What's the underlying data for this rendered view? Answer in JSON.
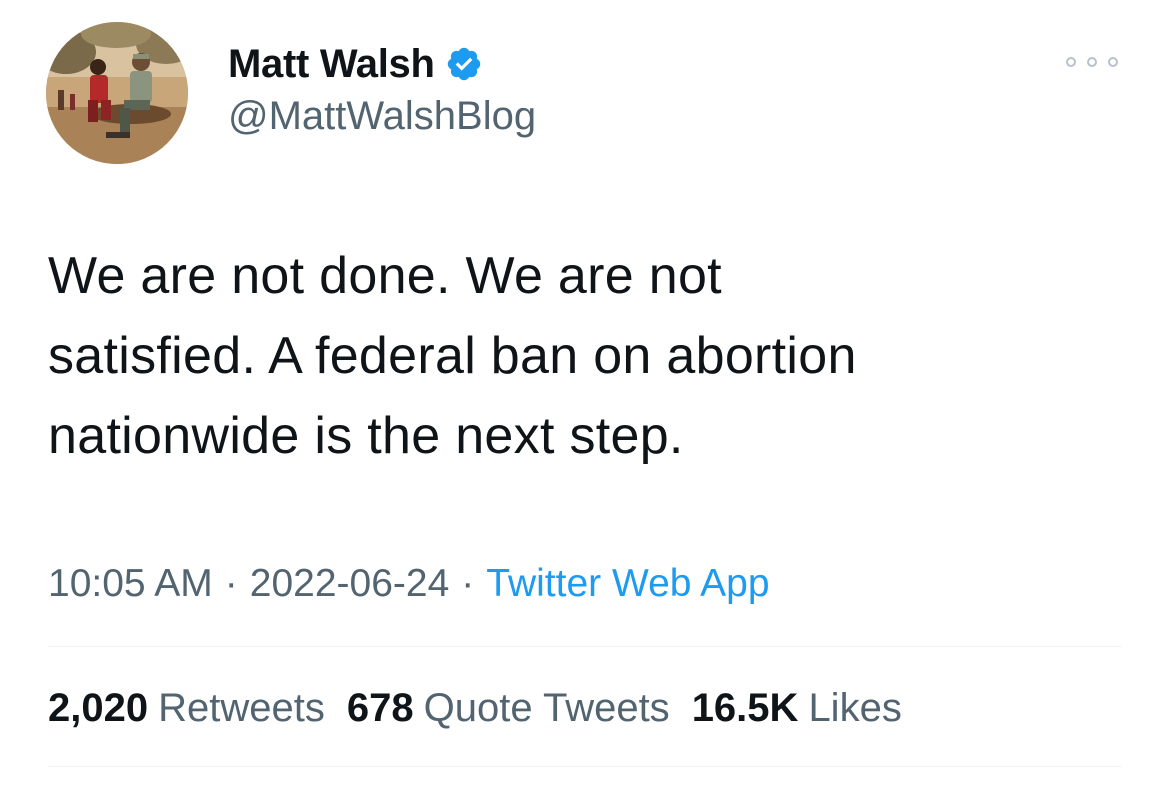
{
  "author": {
    "display_name": "Matt Walsh",
    "handle": "@MattWalshBlog",
    "verified": true,
    "avatar_icon": "profile-photo"
  },
  "tweet": {
    "text_lines": [
      "We are not done. We are not",
      "satisfied. A federal ban on abortion",
      "nationwide is the next step."
    ]
  },
  "meta": {
    "time": "10:05 AM",
    "separator": "·",
    "date": "2022-06-24",
    "source": "Twitter Web App"
  },
  "stats": {
    "retweets": {
      "count": "2,020",
      "label": "Retweets"
    },
    "quote_tweets": {
      "count": "678",
      "label": "Quote Tweets"
    },
    "likes": {
      "count": "16.5K",
      "label": "Likes"
    }
  },
  "colors": {
    "text_primary": "#0f1419",
    "text_secondary": "#536471",
    "link": "#1d9bf0",
    "verified_badge": "#1d9bf0",
    "divider": "#eff3f4"
  }
}
